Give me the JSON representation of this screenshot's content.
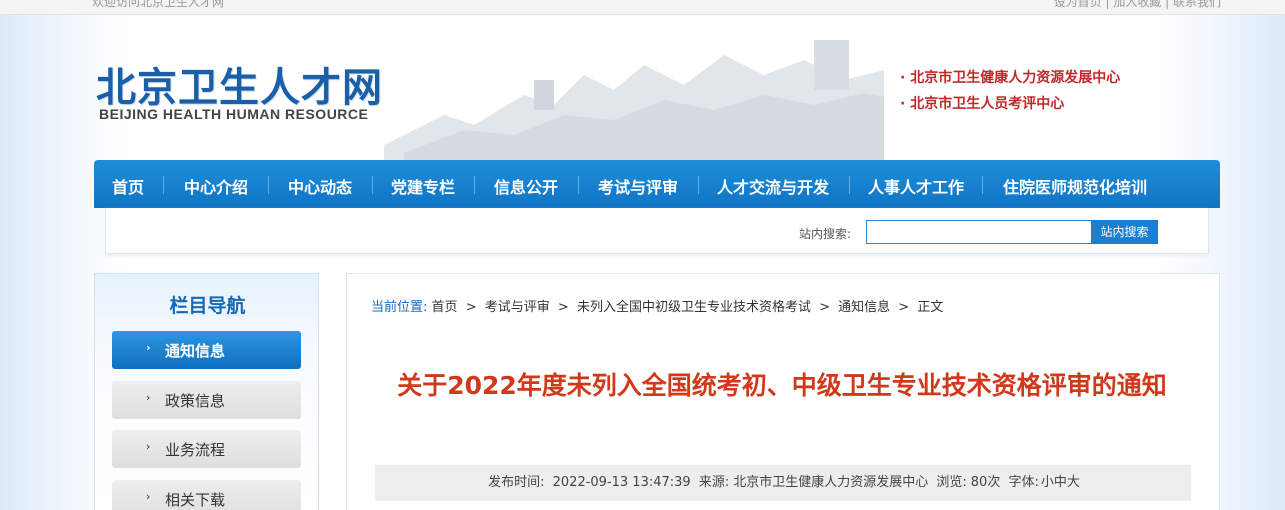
{
  "topbar": {
    "left_text": "欢迎访问北京卫生人才网",
    "right_text": "设为首页 | 加入收藏 | 联系我们"
  },
  "header": {
    "logo_cn": "北京卫生人才网",
    "logo_en": "BEIJING HEALTH HUMAN RESOURCE",
    "org_links": [
      "· 北京市卫生健康人力资源发展中心",
      "· 北京市卫生人员考评中心"
    ]
  },
  "nav": {
    "items": [
      "首页",
      "中心介绍",
      "中心动态",
      "党建专栏",
      "信息公开",
      "考试与评审",
      "人才交流与开发",
      "人事人才工作",
      "住院医师规范化培训"
    ]
  },
  "search": {
    "label": "站内搜索:",
    "placeholder": "",
    "button": "站内搜索"
  },
  "sidebar": {
    "title": "栏目导航",
    "items": [
      {
        "label": "通知信息",
        "active": true
      },
      {
        "label": "政策信息",
        "active": false
      },
      {
        "label": "业务流程",
        "active": false
      },
      {
        "label": "相关下载",
        "active": false
      }
    ],
    "arrow": "›"
  },
  "breadcrumb": {
    "prefix": "当前位置:",
    "items": [
      "首页",
      "考试与评审",
      "未列入全国中初级卫生专业技术资格考试",
      "通知信息",
      "正文"
    ],
    "sep": ">"
  },
  "article": {
    "title": "关于2022年度未列入全国统考初、中级卫生专业技术资格评审的通知",
    "meta": {
      "publish_label": "发布时间:",
      "publish_time": "2022-09-13 13:47:39",
      "source_label": "来源:",
      "source": "北京市卫生健康人力资源发展中心",
      "views_label": "浏览:",
      "views": "80次",
      "font_label": "字体:",
      "font_sizes": [
        "小",
        "中",
        "大"
      ]
    }
  },
  "colors": {
    "nav_blue": "#1480cf",
    "title_red": "#d2391b",
    "org_red": "#c0282a",
    "logo_blue": "#1a5fa8"
  }
}
